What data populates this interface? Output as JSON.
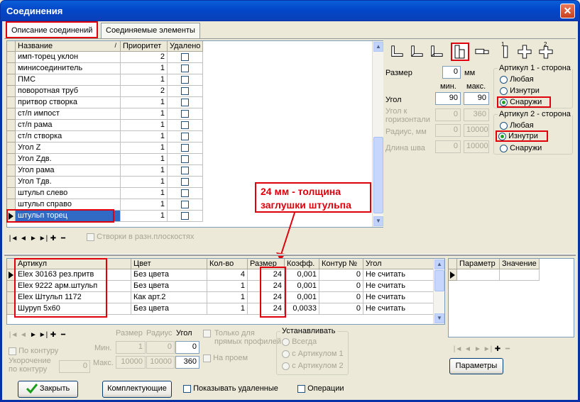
{
  "window": {
    "title": "Соединения",
    "close_glyph": "✕"
  },
  "tabs": [
    {
      "label": "Описание соединений"
    },
    {
      "label": "Соединяемые элементы"
    }
  ],
  "connections": {
    "headers": {
      "name": "Название",
      "sort_glyph": "/",
      "priority": "Приоритет",
      "deleted": "Удалено"
    },
    "rows": [
      {
        "name": "имп-торец уклон",
        "priority": "2"
      },
      {
        "name": "минисоединитель",
        "priority": "1"
      },
      {
        "name": "ПМС",
        "priority": "1"
      },
      {
        "name": "поворотная труб",
        "priority": "2"
      },
      {
        "name": "притвор створка",
        "priority": "1"
      },
      {
        "name": "ст/п импост",
        "priority": "1"
      },
      {
        "name": "ст/п рама",
        "priority": "1"
      },
      {
        "name": "ст/п створка",
        "priority": "1"
      },
      {
        "name": "Угол Z",
        "priority": "1"
      },
      {
        "name": "Угол Zдв.",
        "priority": "1"
      },
      {
        "name": "Угол рама",
        "priority": "1"
      },
      {
        "name": "Угол Тдв.",
        "priority": "1"
      },
      {
        "name": "штульп слево",
        "priority": "1"
      },
      {
        "name": "штульп справо",
        "priority": "1"
      },
      {
        "name": "штульп торец",
        "priority": "1"
      }
    ],
    "nav": [
      "|◄",
      "◄",
      "►",
      "►|",
      "✚",
      "━"
    ],
    "stvorki_label": "Створки в разн.плоскостях"
  },
  "params": {
    "size_label": "Размер",
    "size_value": "0",
    "mm": "мм",
    "min_label": "мин.",
    "max_label": "макс.",
    "angle_label": "Угол",
    "angle_min": "90",
    "angle_max": "90",
    "horiz_label": "Угол к горизонтали",
    "horiz_min": "0",
    "horiz_max": "360",
    "radius_label": "Радиус, мм",
    "radius_min": "0",
    "radius_max": "10000",
    "seam_label": "Длина шва",
    "seam_min": "0",
    "seam_max": "10000",
    "icon_label_2": "2",
    "icon_label_1": "1",
    "art1": {
      "title": "Артикул 1 - сторона",
      "options": [
        "Любая",
        "Изнутри",
        "Снаружи"
      ],
      "selected": 2
    },
    "art2": {
      "title": "Артикул 2 - сторона",
      "options": [
        "Любая",
        "Изнутри",
        "Снаружи"
      ],
      "selected": 1
    }
  },
  "annotation": {
    "text": "24 мм - толщина заглушки штульпа",
    "color": "#e0000c"
  },
  "articles": {
    "headers": {
      "article": "Артикул",
      "color": "Цвет",
      "qty": "Кол-во",
      "size": "Размер",
      "coef": "Коэфф.",
      "contour": "Контур №",
      "angle": "Угол"
    },
    "rows": [
      {
        "article": "Elex 30163 рез.притв",
        "color": "Без цвета",
        "qty": "4",
        "size": "24",
        "coef": "0,001",
        "contour": "0",
        "angle": "Не считать"
      },
      {
        "article": "Elex 9222 арм.штульп",
        "color": "Без цвета",
        "qty": "1",
        "size": "24",
        "coef": "0,001",
        "contour": "0",
        "angle": "Не считать"
      },
      {
        "article": "Elex Штульп 1172",
        "color": "Как арт.2",
        "qty": "1",
        "size": "24",
        "coef": "0,001",
        "contour": "0",
        "angle": "Не считать"
      },
      {
        "article": "Шуруп 5x60",
        "color": "Без цвета",
        "qty": "1",
        "size": "24",
        "coef": "0,0033",
        "contour": "0",
        "angle": "Не считать"
      }
    ]
  },
  "param_grid": {
    "headers": {
      "param": "Параметр",
      "value": "Значение"
    },
    "button": "Параметры"
  },
  "bottom": {
    "nav": [
      "|◄",
      "◄",
      "►",
      "►|",
      "✚",
      "━"
    ],
    "by_contour": "По контуру",
    "shorten": "Укорочение по контуру",
    "shorten_value": "0",
    "col_size": "Размер",
    "col_radius": "Радиус",
    "col_angle": "Угол",
    "min_label": "Мин.",
    "max_label": "Макс.",
    "min_size": "1",
    "min_radius": "0",
    "min_angle": "0",
    "max_size": "10000",
    "max_radius": "10000",
    "max_angle": "360",
    "straight_only": "Только для прямых профилей",
    "on_passage": "На проем",
    "install": {
      "title": "Устанавливать",
      "options": [
        "Всегда",
        "с Артикулом 1",
        "с Артикулом 2"
      ]
    }
  },
  "footer": {
    "close_button": "Закрыть",
    "complect_button": "Комплектующие",
    "show_deleted": "Показывать удаленные",
    "operations": "Операции"
  }
}
